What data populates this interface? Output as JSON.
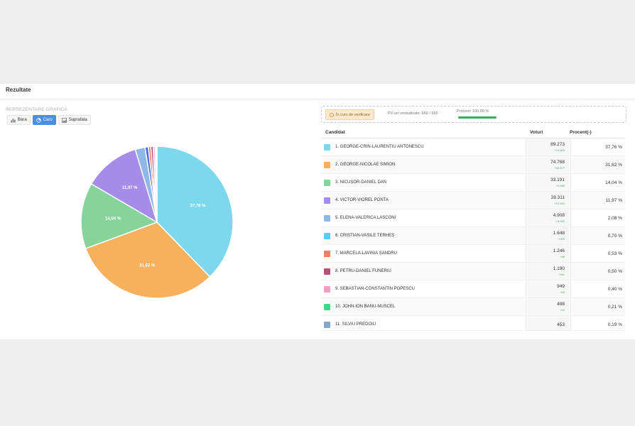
{
  "header": {
    "title": "Rezultate"
  },
  "chart_section": {
    "label": "REPREZENTARE GRAFICĂ",
    "buttons": [
      {
        "label": "Bara",
        "icon": "bar-chart-icon",
        "active": false
      },
      {
        "label": "Caro",
        "icon": "pie-chart-icon",
        "active": true
      },
      {
        "label": "Suprafata",
        "icon": "area-chart-icon",
        "active": false
      }
    ]
  },
  "status": {
    "badge": "În curs de verificare",
    "pv": "PV-uri centralizate: 660 / 660",
    "procent": "Procent: 100,00 %",
    "progress": 1.0,
    "progress_color": "#3aaa5c"
  },
  "table": {
    "headers": {
      "candidate": "Candidat",
      "votes": "Voturi",
      "percent": "Procent(-)"
    },
    "rows": [
      {
        "name": "1. GEORGE-CRIN-LAURENȚIU ANTONESCU",
        "votes": "89.273",
        "delta": "+14.905",
        "percent": "37,76 %",
        "color": "#7dd8ee"
      },
      {
        "name": "2. GEORGE-NICOLAE SIMION",
        "votes": "74.768",
        "delta": "+40.577",
        "percent": "31,62 %",
        "color": "#f7b05b"
      },
      {
        "name": "3. NICUȘOR-DANIEL DAN",
        "votes": "33.191",
        "delta": "+9.880",
        "percent": "14,04 %",
        "color": "#86d49c"
      },
      {
        "name": "4. VICTOR-VIOREL PONTA",
        "votes": "28.311",
        "delta": "+13.463",
        "percent": "11,97 %",
        "color": "#a48ce8"
      },
      {
        "name": "5. ELENA-VALERICA LASCONI",
        "votes": "4.908",
        "delta": "+3.280",
        "percent": "2,08 %",
        "color": "#8fb8e8"
      },
      {
        "name": "6. CRISTIAN-VASILE TERHEȘ",
        "votes": "1.648",
        "delta": "+902",
        "percent": "0,70 %",
        "color": "#5ccdf2"
      },
      {
        "name": "7. MARCELA-LAVINIA ȘANDRU",
        "votes": "1.246",
        "delta": "+68",
        "percent": "0,53 %",
        "color": "#ee8060"
      },
      {
        "name": "8. PETRU-DANIEL FUNERIU",
        "votes": "1.190",
        "delta": "+281",
        "percent": "0,50 %",
        "color": "#b8507a"
      },
      {
        "name": "9. SEBASTIAN-CONSTANTIN POPESCU",
        "votes": "949",
        "delta": "+80",
        "percent": "0,40 %",
        "color": "#f39cc4"
      },
      {
        "name": "10. JOHN-ION BANU-MUSCEL",
        "votes": "498",
        "delta": "+44",
        "percent": "0,21 %",
        "color": "#3fd88a"
      },
      {
        "name": "11. SILVIU PREDOIU",
        "votes": "453",
        "delta": "",
        "percent": "0,19 %",
        "color": "#86a6cc"
      }
    ]
  },
  "chart_data": {
    "type": "pie",
    "categories": [
      "1. GEORGE-CRIN-LAURENȚIU ANTONESCU",
      "2. GEORGE-NICOLAE SIMION",
      "3. NICUȘOR-DANIEL DAN",
      "4. VICTOR-VIOREL PONTA",
      "5. ELENA-VALERICA LASCONI",
      "6. CRISTIAN-VASILE TERHEȘ",
      "7. MARCELA-LAVINIA ȘANDRU",
      "8. PETRU-DANIEL FUNERIU",
      "9. SEBASTIAN-CONSTANTIN POPESCU",
      "10. JOHN-ION BANU-MUSCEL",
      "11. SILVIU PREDOIU"
    ],
    "values": [
      37.76,
      31.62,
      14.04,
      11.97,
      2.08,
      0.7,
      0.53,
      0.5,
      0.4,
      0.21,
      0.19
    ],
    "labels": [
      "37,76 %",
      "31,62 %",
      "14,04 %",
      "11,97 %",
      "",
      "",
      "",
      "",
      "",
      "",
      ""
    ],
    "colors": [
      "#7dd8ee",
      "#f7b05b",
      "#86d49c",
      "#a48ce8",
      "#8fb8e8",
      "#4a6ad6",
      "#ee8060",
      "#b8507a",
      "#f39cc4",
      "#3fd88a",
      "#86a6cc"
    ]
  }
}
